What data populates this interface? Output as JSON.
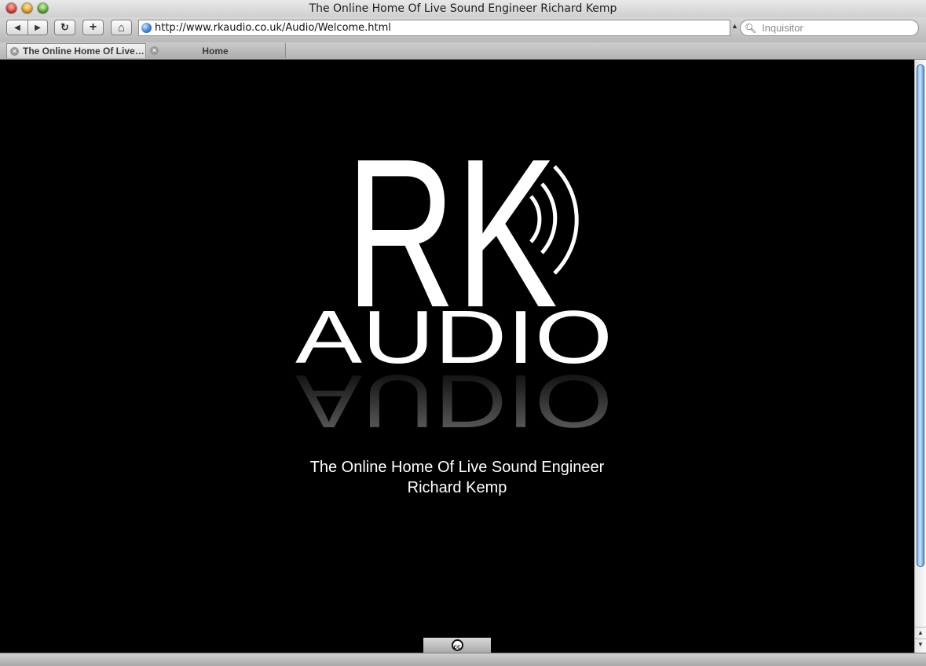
{
  "window": {
    "title": "The Online Home Of Live Sound Engineer Richard Kemp"
  },
  "toolbar": {
    "back_icon": "◀",
    "forward_icon": "▶",
    "reload_icon": "↻",
    "newtab_icon": "+",
    "home_icon": "⌂",
    "url": "http://www.rkaudio.co.uk/Audio/Welcome.html",
    "search_placeholder": "Inquisitor"
  },
  "tabs": [
    {
      "label": "The Online Home Of Live Sound Engineer Richard Kemp",
      "active": true
    },
    {
      "label": "Home",
      "active": false
    }
  ],
  "page": {
    "logo": {
      "letters": "RK",
      "word": "AUDIO"
    },
    "tagline_line1": "The Online Home Of Live Sound Engineer",
    "tagline_line2": "Richard Kemp",
    "cc_badge": "cc"
  },
  "colors": {
    "page_bg": "#000000",
    "text": "#ffffff",
    "scroll_thumb": "#5aa0e8"
  }
}
